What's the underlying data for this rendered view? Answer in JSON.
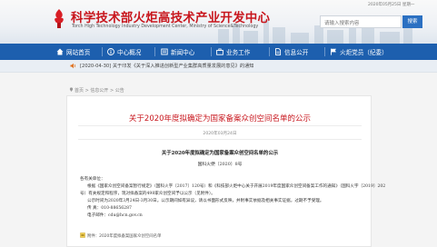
{
  "header": {
    "org_name_cn": "科学技术部火炬高技术产业开发中心",
    "org_name_en": "Torch High Technology Industry Development Center, Ministry of Science&Technology",
    "date": "2020年05月25日  星期一",
    "search_placeholder": "请输入搜索内容",
    "search_button": "搜索"
  },
  "nav": {
    "items": [
      {
        "label": "网站首页",
        "icon": "home-icon"
      },
      {
        "label": "中心概况",
        "icon": "info-icon"
      },
      {
        "label": "新闻中心",
        "icon": "news-icon"
      },
      {
        "label": "业务工作",
        "icon": "briefcase-icon"
      },
      {
        "label": "信息公开",
        "icon": "document-icon"
      },
      {
        "label": "火炬党员（纪委）",
        "icon": "flag-icon"
      }
    ]
  },
  "notice": {
    "text": "[2020-04-30] 关于印发《关于深入推进创新型产业集群高质量发展的意见》的通知"
  },
  "breadcrumb": "首页 > 信息公开 > 公告",
  "article": {
    "title": "关于2020年度拟确定为国家备案众创空间名单的公示",
    "date": "2020年03月24日",
    "doc_title": "关于2020年度拟确定为国家备案众创空间名单的公示",
    "doc_number": "国科火便〔2020〕8号",
    "salutation": "各有关单位：",
    "body": [
      "根据《国家众创空间备案暂行规定》（国科火字〔2017〕120号）和《科技部火炬中心关于开展2019年度国家众创空间备案工作的通知》（国科火字〔2019〕202",
      "号）有关规定和程序，现对拟备案的498家众创空间予以公示（见附件）。",
      "公示时间为2020年3月24日-3月30日。公示期间如有异议，请以书面形式反映，并附事实依据及相关事实证据，过期不予受理。",
      "传  真：010-88656287",
      "电子邮件：cdu@hcn.gov.cn"
    ],
    "attachment": "附件：2020年度拟备案国家众创空间名单"
  }
}
